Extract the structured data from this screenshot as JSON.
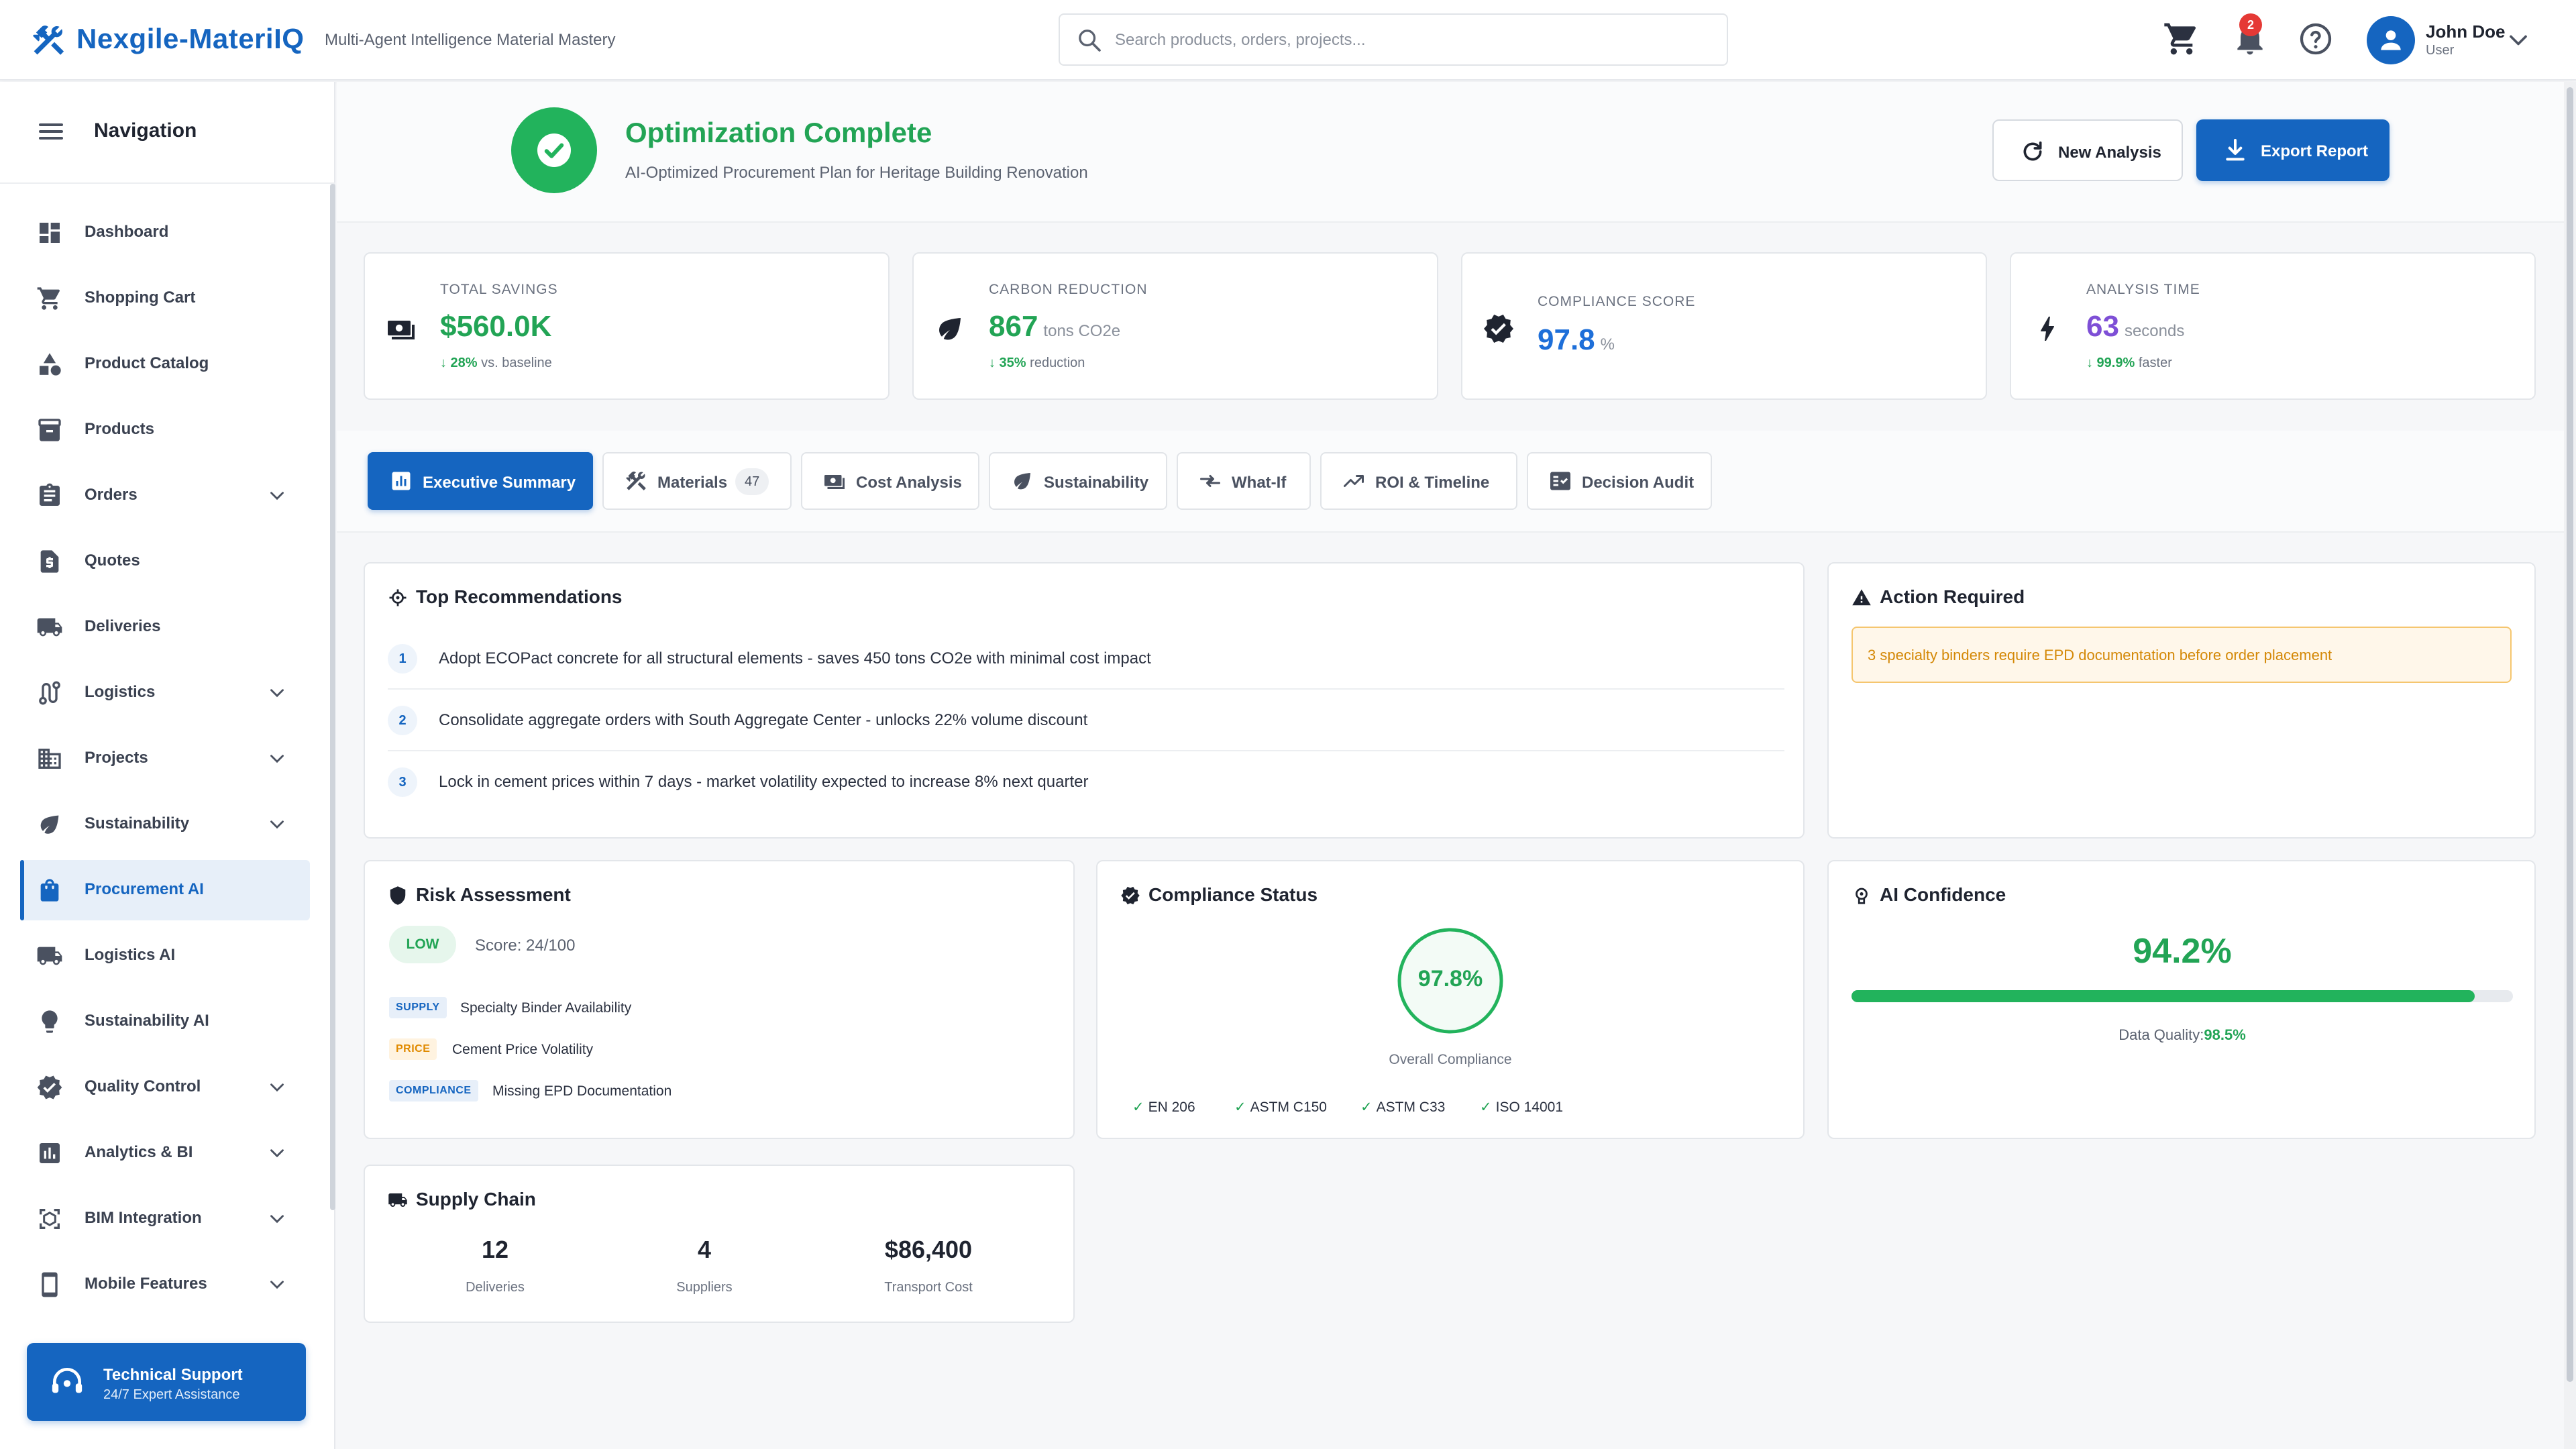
{
  "app": {
    "brand": "Nexgile-MateriIQ",
    "tagline": "Multi-Agent Intelligence Material Mastery"
  },
  "search": {
    "placeholder": "Search products, orders, projects..."
  },
  "header": {
    "notification_count": "2"
  },
  "user": {
    "name": "John Doe",
    "role": "User"
  },
  "sidebar": {
    "title": "Navigation",
    "items": [
      {
        "label": "Dashboard",
        "icon": "dashboard-icon",
        "expandable": false
      },
      {
        "label": "Shopping Cart",
        "icon": "cart-icon",
        "expandable": false
      },
      {
        "label": "Product Catalog",
        "icon": "category-icon",
        "expandable": false
      },
      {
        "label": "Products",
        "icon": "inventory-icon",
        "expandable": false
      },
      {
        "label": "Orders",
        "icon": "clipboard-icon",
        "expandable": true
      },
      {
        "label": "Quotes",
        "icon": "document-dollar-icon",
        "expandable": false
      },
      {
        "label": "Deliveries",
        "icon": "truck-icon",
        "expandable": false
      },
      {
        "label": "Logistics",
        "icon": "route-icon",
        "expandable": true
      },
      {
        "label": "Projects",
        "icon": "building-icon",
        "expandable": true
      },
      {
        "label": "Sustainability",
        "icon": "leaf-icon",
        "expandable": true
      },
      {
        "label": "Procurement AI",
        "icon": "shopping-bag-icon",
        "expandable": false,
        "active": true
      },
      {
        "label": "Logistics AI",
        "icon": "truck-icon",
        "expandable": false
      },
      {
        "label": "Sustainability AI",
        "icon": "lightbulb-icon",
        "expandable": false
      },
      {
        "label": "Quality Control",
        "icon": "verified-icon",
        "expandable": true
      },
      {
        "label": "Analytics & BI",
        "icon": "bar-chart-icon",
        "expandable": true
      },
      {
        "label": "BIM Integration",
        "icon": "3d-view-icon",
        "expandable": true
      },
      {
        "label": "Mobile Features",
        "icon": "phone-icon",
        "expandable": true
      }
    ],
    "support": {
      "title": "Technical Support",
      "subtitle": "24/7 Expert Assistance"
    }
  },
  "hero": {
    "title": "Optimization Complete",
    "subtitle": "AI-Optimized Procurement Plan for Heritage Building Renovation",
    "new_analysis_label": "New Analysis",
    "export_label": "Export Report"
  },
  "kpis": [
    {
      "label": "TOTAL SAVINGS",
      "value": "$560.0K",
      "unit": "",
      "delta_value": "↓ 28%",
      "delta_text": "vs. baseline",
      "color": "#22a455"
    },
    {
      "label": "CARBON REDUCTION",
      "value": "867",
      "unit": "tons CO2e",
      "delta_value": "↓ 35%",
      "delta_text": "reduction",
      "color": "#22a455"
    },
    {
      "label": "COMPLIANCE SCORE",
      "value": "97.8",
      "unit": "%",
      "delta_value": "",
      "delta_text": "",
      "color": "#1e6fd9"
    },
    {
      "label": "ANALYSIS TIME",
      "value": "63",
      "unit": "seconds",
      "delta_value": "↓ 99.9%",
      "delta_text": "faster",
      "color": "#7e4fd6"
    }
  ],
  "tabs": [
    {
      "label": "Executive Summary",
      "active": true
    },
    {
      "label": "Materials",
      "count": "47"
    },
    {
      "label": "Cost Analysis"
    },
    {
      "label": "Sustainability"
    },
    {
      "label": "What-If"
    },
    {
      "label": "ROI & Timeline"
    },
    {
      "label": "Decision Audit"
    }
  ],
  "recommendations": {
    "title": "Top Recommendations",
    "items": [
      {
        "num": "1",
        "text": "Adopt ECOPact concrete for all structural elements - saves 450 tons CO2e with minimal cost impact"
      },
      {
        "num": "2",
        "text": "Consolidate aggregate orders with South Aggregate Center - unlocks 22% volume discount"
      },
      {
        "num": "3",
        "text": "Lock in cement prices within 7 days - market volatility expected to increase 8% next quarter"
      }
    ]
  },
  "action": {
    "title": "Action Required",
    "message": "3 specialty binders require EPD documentation before order placement"
  },
  "risk": {
    "title": "Risk Assessment",
    "level": "LOW",
    "score": "Score: 24/100",
    "items": [
      {
        "tag": "SUPPLY",
        "text": "Specialty Binder Availability",
        "tag_bg": "#e7eff9",
        "tag_fg": "#1565c0"
      },
      {
        "tag": "PRICE",
        "text": "Cement Price Volatility",
        "tag_bg": "#fff3e0",
        "tag_fg": "#e08a00"
      },
      {
        "tag": "COMPLIANCE",
        "text": "Missing EPD Documentation",
        "tag_bg": "#e7eff9",
        "tag_fg": "#1565c0"
      }
    ]
  },
  "compliance": {
    "title": "Compliance Status",
    "value": "97.8%",
    "percent": 97.8,
    "caption": "Overall Compliance",
    "standards": [
      "EN 206",
      "ASTM C150",
      "ASTM C33",
      "ISO 14001"
    ]
  },
  "confidence": {
    "title": "AI Confidence",
    "value": "94.2%",
    "percent": 94.2,
    "quality_label": "Data Quality:",
    "quality_value": "98.5%"
  },
  "supply_chain": {
    "title": "Supply Chain",
    "stats": [
      {
        "value": "12",
        "label": "Deliveries"
      },
      {
        "value": "4",
        "label": "Suppliers"
      },
      {
        "value": "$86,400",
        "label": "Transport Cost"
      }
    ]
  },
  "colors": {
    "brand": "#1565c0",
    "success": "#22a455",
    "warning": "#d48806",
    "purple": "#7e4fd6"
  }
}
